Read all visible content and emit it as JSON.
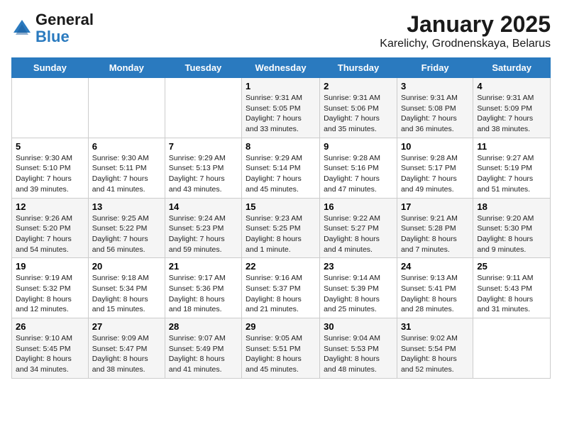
{
  "logo": {
    "line1": "General",
    "line2": "Blue"
  },
  "title": "January 2025",
  "subtitle": "Karelichy, Grodnenskaya, Belarus",
  "weekdays": [
    "Sunday",
    "Monday",
    "Tuesday",
    "Wednesday",
    "Thursday",
    "Friday",
    "Saturday"
  ],
  "weeks": [
    [
      {
        "day": "",
        "text": ""
      },
      {
        "day": "",
        "text": ""
      },
      {
        "day": "",
        "text": ""
      },
      {
        "day": "1",
        "text": "Sunrise: 9:31 AM\nSunset: 5:05 PM\nDaylight: 7 hours\nand 33 minutes."
      },
      {
        "day": "2",
        "text": "Sunrise: 9:31 AM\nSunset: 5:06 PM\nDaylight: 7 hours\nand 35 minutes."
      },
      {
        "day": "3",
        "text": "Sunrise: 9:31 AM\nSunset: 5:08 PM\nDaylight: 7 hours\nand 36 minutes."
      },
      {
        "day": "4",
        "text": "Sunrise: 9:31 AM\nSunset: 5:09 PM\nDaylight: 7 hours\nand 38 minutes."
      }
    ],
    [
      {
        "day": "5",
        "text": "Sunrise: 9:30 AM\nSunset: 5:10 PM\nDaylight: 7 hours\nand 39 minutes."
      },
      {
        "day": "6",
        "text": "Sunrise: 9:30 AM\nSunset: 5:11 PM\nDaylight: 7 hours\nand 41 minutes."
      },
      {
        "day": "7",
        "text": "Sunrise: 9:29 AM\nSunset: 5:13 PM\nDaylight: 7 hours\nand 43 minutes."
      },
      {
        "day": "8",
        "text": "Sunrise: 9:29 AM\nSunset: 5:14 PM\nDaylight: 7 hours\nand 45 minutes."
      },
      {
        "day": "9",
        "text": "Sunrise: 9:28 AM\nSunset: 5:16 PM\nDaylight: 7 hours\nand 47 minutes."
      },
      {
        "day": "10",
        "text": "Sunrise: 9:28 AM\nSunset: 5:17 PM\nDaylight: 7 hours\nand 49 minutes."
      },
      {
        "day": "11",
        "text": "Sunrise: 9:27 AM\nSunset: 5:19 PM\nDaylight: 7 hours\nand 51 minutes."
      }
    ],
    [
      {
        "day": "12",
        "text": "Sunrise: 9:26 AM\nSunset: 5:20 PM\nDaylight: 7 hours\nand 54 minutes."
      },
      {
        "day": "13",
        "text": "Sunrise: 9:25 AM\nSunset: 5:22 PM\nDaylight: 7 hours\nand 56 minutes."
      },
      {
        "day": "14",
        "text": "Sunrise: 9:24 AM\nSunset: 5:23 PM\nDaylight: 7 hours\nand 59 minutes."
      },
      {
        "day": "15",
        "text": "Sunrise: 9:23 AM\nSunset: 5:25 PM\nDaylight: 8 hours\nand 1 minute."
      },
      {
        "day": "16",
        "text": "Sunrise: 9:22 AM\nSunset: 5:27 PM\nDaylight: 8 hours\nand 4 minutes."
      },
      {
        "day": "17",
        "text": "Sunrise: 9:21 AM\nSunset: 5:28 PM\nDaylight: 8 hours\nand 7 minutes."
      },
      {
        "day": "18",
        "text": "Sunrise: 9:20 AM\nSunset: 5:30 PM\nDaylight: 8 hours\nand 9 minutes."
      }
    ],
    [
      {
        "day": "19",
        "text": "Sunrise: 9:19 AM\nSunset: 5:32 PM\nDaylight: 8 hours\nand 12 minutes."
      },
      {
        "day": "20",
        "text": "Sunrise: 9:18 AM\nSunset: 5:34 PM\nDaylight: 8 hours\nand 15 minutes."
      },
      {
        "day": "21",
        "text": "Sunrise: 9:17 AM\nSunset: 5:36 PM\nDaylight: 8 hours\nand 18 minutes."
      },
      {
        "day": "22",
        "text": "Sunrise: 9:16 AM\nSunset: 5:37 PM\nDaylight: 8 hours\nand 21 minutes."
      },
      {
        "day": "23",
        "text": "Sunrise: 9:14 AM\nSunset: 5:39 PM\nDaylight: 8 hours\nand 25 minutes."
      },
      {
        "day": "24",
        "text": "Sunrise: 9:13 AM\nSunset: 5:41 PM\nDaylight: 8 hours\nand 28 minutes."
      },
      {
        "day": "25",
        "text": "Sunrise: 9:11 AM\nSunset: 5:43 PM\nDaylight: 8 hours\nand 31 minutes."
      }
    ],
    [
      {
        "day": "26",
        "text": "Sunrise: 9:10 AM\nSunset: 5:45 PM\nDaylight: 8 hours\nand 34 minutes."
      },
      {
        "day": "27",
        "text": "Sunrise: 9:09 AM\nSunset: 5:47 PM\nDaylight: 8 hours\nand 38 minutes."
      },
      {
        "day": "28",
        "text": "Sunrise: 9:07 AM\nSunset: 5:49 PM\nDaylight: 8 hours\nand 41 minutes."
      },
      {
        "day": "29",
        "text": "Sunrise: 9:05 AM\nSunset: 5:51 PM\nDaylight: 8 hours\nand 45 minutes."
      },
      {
        "day": "30",
        "text": "Sunrise: 9:04 AM\nSunset: 5:53 PM\nDaylight: 8 hours\nand 48 minutes."
      },
      {
        "day": "31",
        "text": "Sunrise: 9:02 AM\nSunset: 5:54 PM\nDaylight: 8 hours\nand 52 minutes."
      },
      {
        "day": "",
        "text": ""
      }
    ]
  ]
}
